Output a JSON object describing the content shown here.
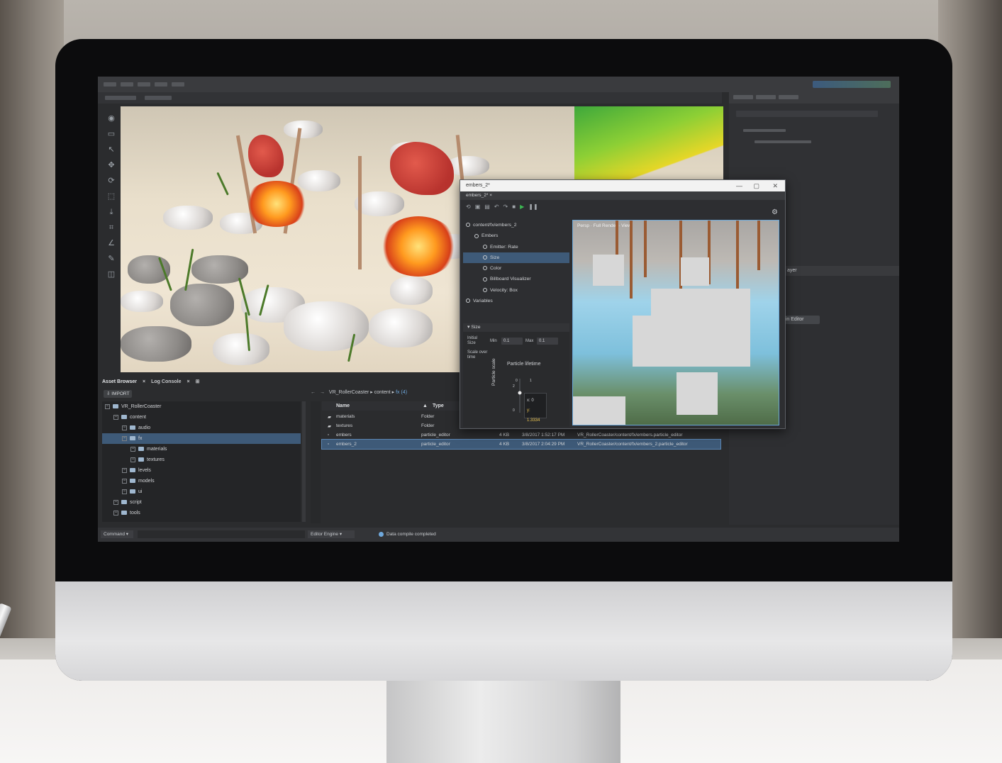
{
  "editor": {
    "viewport_label": "3D viewport",
    "bottom_tabs": [
      "Asset Browser",
      "Log Console"
    ],
    "import_label": "IMPORT",
    "tree": [
      {
        "label": "VR_RollerCoaster",
        "depth": 0,
        "selected": false
      },
      {
        "label": "content",
        "depth": 1,
        "selected": false
      },
      {
        "label": "audio",
        "depth": 2,
        "selected": false
      },
      {
        "label": "fx",
        "depth": 2,
        "selected": true
      },
      {
        "label": "materials",
        "depth": 3,
        "selected": false
      },
      {
        "label": "textures",
        "depth": 3,
        "selected": false
      },
      {
        "label": "levels",
        "depth": 2,
        "selected": false
      },
      {
        "label": "models",
        "depth": 2,
        "selected": false
      },
      {
        "label": "ui",
        "depth": 2,
        "selected": false
      },
      {
        "label": "script",
        "depth": 1,
        "selected": false
      },
      {
        "label": "tools",
        "depth": 1,
        "selected": false
      }
    ],
    "breadcrumb": {
      "root": "VR_RollerCoaster",
      "mid": "content",
      "leaf": "fx (4)"
    },
    "file_columns": {
      "name": "Name",
      "type": "Type"
    },
    "files": [
      {
        "name": "materials",
        "type": "Folder",
        "size": "",
        "date": "",
        "path": "",
        "selected": false
      },
      {
        "name": "textures",
        "type": "Folder",
        "size": "",
        "date": "",
        "path": "",
        "selected": false
      },
      {
        "name": "embers",
        "type": "particle_editor",
        "size": "4 KB",
        "date": "3/8/2017 1:52:17 PM",
        "path": "VR_RollerCoaster/content/fx/embers.particle_editor",
        "selected": false
      },
      {
        "name": "embers_2",
        "type": "particle_editor",
        "size": "4 KB",
        "date": "3/8/2017 2:04:29 PM",
        "path": "VR_RollerCoaster/content/fx/embers_2.particle_editor",
        "selected": true
      }
    ],
    "status": {
      "command": "Command",
      "engine": "Editor Engine",
      "message": "Data compile completed"
    },
    "right_panel": {
      "tab": "ayer",
      "button": "n in Editor"
    }
  },
  "particle_editor": {
    "window_title": "embers_2*",
    "tab_label": "embers_2*",
    "tree": [
      {
        "label": "content/fx/embers_2",
        "depth": 0,
        "selected": false
      },
      {
        "label": "Embers",
        "depth": 1,
        "selected": false
      },
      {
        "label": "Emitter: Rate",
        "depth": 2,
        "selected": false
      },
      {
        "label": "Size",
        "depth": 2,
        "selected": true
      },
      {
        "label": "Color",
        "depth": 2,
        "selected": false
      },
      {
        "label": "Billboard Visualizer",
        "depth": 2,
        "selected": false
      },
      {
        "label": "Velocity: Box",
        "depth": 2,
        "selected": false
      },
      {
        "label": "Variables",
        "depth": 0,
        "selected": false
      }
    ],
    "props": {
      "section": "Size",
      "initial_size_label": "Initial Size",
      "min_label": "Min",
      "min_value": "0.1",
      "max_label": "Max",
      "max_value": "0.1",
      "scale_label": "Scale over time",
      "graph_title": "Particle lifetime",
      "graph_ylabel": "Particle scale",
      "graph_ticks": [
        "0",
        "1",
        "2",
        "0"
      ],
      "tooltip_x": "x: 0",
      "tooltip_y": "y: 1.3334"
    },
    "preview_label": "Persp · Full Render · View"
  },
  "colors": {
    "accent": "#3e5a78",
    "play": "#3db853",
    "link": "#6fa8dc"
  }
}
